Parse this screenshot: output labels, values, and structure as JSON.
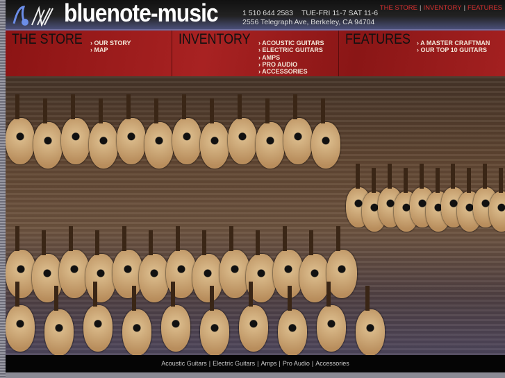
{
  "header": {
    "logo_text": "bluenote-music",
    "phone": "1 510 644 2583",
    "hours": "TUE-FRI 11-7 SAT 11-6",
    "address": "2556 Telegraph Ave, Berkeley, CA 94704",
    "top_links": [
      "THE STORE",
      "INVENTORY",
      "FEATURES"
    ]
  },
  "nav": [
    {
      "title": "THE STORE",
      "items": [
        "OUR STORY",
        "MAP"
      ]
    },
    {
      "title": "INVENTORY",
      "items": [
        "ACOUSTIC GUITARS",
        "ELECTRIC GUITARS",
        "AMPS",
        "PRO AUDIO",
        "ACCESSORIES"
      ]
    },
    {
      "title": "FEATURES",
      "items": [
        "A MASTER CRAFTMAN",
        "OUR TOP 10 GUITARS"
      ]
    }
  ],
  "footer": {
    "links": [
      "Acoustic Guitars",
      "Electric Guitars",
      "Amps",
      "Pro Audio",
      "Accessories"
    ]
  },
  "colors": {
    "accent": "#d63030",
    "nav_bg": "#9a1c1c",
    "logo_blue": "#5a7bd8"
  }
}
